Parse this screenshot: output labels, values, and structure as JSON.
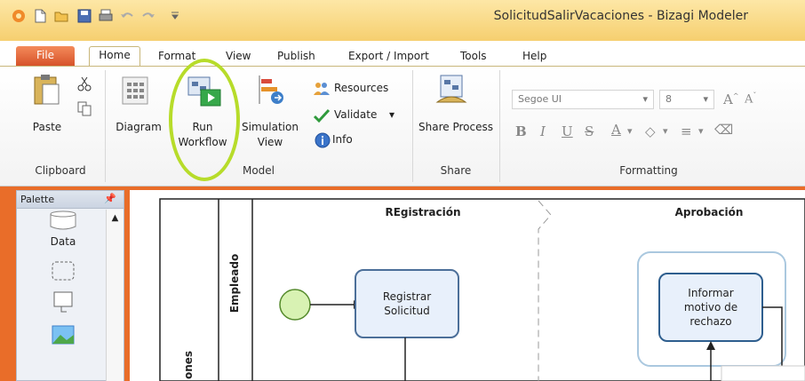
{
  "window": {
    "title": "SolicitudSalirVacaciones - Bizagi Modeler"
  },
  "tabs": [
    "File",
    "Home",
    "Format",
    "View",
    "Publish",
    "Export / Import",
    "Tools",
    "Help"
  ],
  "ribbon": {
    "clipboard": {
      "paste": "Paste",
      "group": "Clipboard"
    },
    "model": {
      "diagram": "Diagram",
      "run_workflow_1": "Run",
      "run_workflow_2": "Workflow",
      "simulation_1": "Simulation",
      "simulation_2": "View",
      "resources": "Resources",
      "validate": "Validate",
      "info": "Info",
      "group": "Model"
    },
    "share": {
      "share_process": "Share Process",
      "group": "Share"
    },
    "formatting": {
      "font": "Segoe UI",
      "size": "8",
      "group": "Formatting"
    }
  },
  "palette": {
    "title": "Palette",
    "data_label": "Data"
  },
  "diagram": {
    "lane_registracion": "REgistración",
    "lane_aprobacion": "Aprobación",
    "lane_empleado": "Empleado",
    "pool_fragment": "ones",
    "task_registrar_1": "Registrar",
    "task_registrar_2": "Solicitud",
    "task_informar_1": "Informar",
    "task_informar_2": "motivo de",
    "task_informar_3": "rechazo"
  }
}
